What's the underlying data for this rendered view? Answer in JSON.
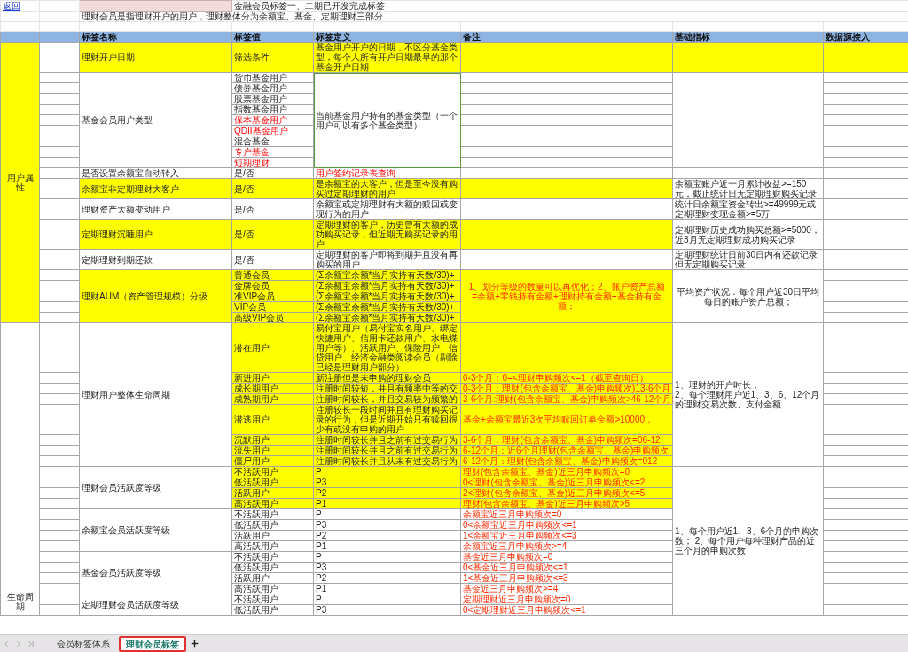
{
  "back_link": "返回",
  "title": "金融会员标签一、二期已开发完成标签",
  "description": "理财会员是指理财开户的用户，理财整体分为余额宝、基金、定期理财三部分",
  "columns": [
    "标签名称",
    "标签值",
    "标签定义",
    "备注",
    "基础指标",
    "数据源接入"
  ],
  "sections": [
    {
      "category": "用户属性",
      "highlighted": true,
      "blocks": [
        {
          "highlighted": true,
          "groups": [
            {
              "name": "理财开户日期",
              "highlighted": true,
              "definition_red": false,
              "rows": [
                {
                  "value": "筛选条件",
                  "red": false,
                  "highlighted": true,
                  "definition": "基金用户开户的日期，不区分基金类型，每个人所有开户日期最早的那个基金开户日期"
                }
              ]
            }
          ]
        },
        {
          "highlighted": false,
          "groups": [
            {
              "name": "基金会员用户类型",
              "highlighted": false,
              "definition_red": false,
              "definition": "当前基金用户持有的基金类型（一个用户可以有多个基金类型）",
              "rows": [
                {
                  "value": "货币基金用户",
                  "red": false,
                  "highlighted": false
                },
                {
                  "value": "债券基金用户",
                  "red": false,
                  "highlighted": false
                },
                {
                  "value": "股票基金用户",
                  "red": false,
                  "highlighted": false
                },
                {
                  "value": "指数基金用户",
                  "red": false,
                  "highlighted": false
                },
                {
                  "value": "保本基金用户",
                  "red": true,
                  "highlighted": false
                },
                {
                  "value": "QDII基金用户",
                  "red": true,
                  "highlighted": false
                },
                {
                  "value": "混合基金",
                  "red": false,
                  "highlighted": false
                },
                {
                  "value": "专户基金",
                  "red": true,
                  "highlighted": false
                },
                {
                  "value": "短期理财",
                  "red": true,
                  "highlighted": false
                }
              ]
            }
          ]
        },
        {
          "highlighted": false,
          "groups": [
            {
              "name": "是否设置余额宝自动转入",
              "highlighted": false,
              "definition_red": true,
              "rows": [
                {
                  "value": "是/否",
                  "red": false,
                  "highlighted": false,
                  "definition": "用户签约记录表查询"
                }
              ]
            }
          ]
        },
        {
          "highlighted": false,
          "metric": "余额宝账户近一月累计收益>=150元，截止统计日无定期理财购买记录",
          "groups": [
            {
              "name": "余额宝非定期理财大客户",
              "highlighted": true,
              "definition_red": false,
              "rows": [
                {
                  "value": "是/否",
                  "red": false,
                  "highlighted": true,
                  "definition": "是余额宝的大客户，但是至今没有购买过定期理财的用户"
                }
              ]
            }
          ]
        },
        {
          "highlighted": false,
          "metric": "统计日余额宝资金转出>=49999元或定期理财变现金额>=5万",
          "groups": [
            {
              "name": "理财资产大额变动用户",
              "highlighted": false,
              "definition_red": false,
              "rows": [
                {
                  "value": "是/否",
                  "red": false,
                  "highlighted": false,
                  "definition": "余额宝或定期理财有大额的赎回或变现行为的用户"
                }
              ]
            }
          ]
        },
        {
          "highlighted": false,
          "metric": "定期理财历史成功购买总额>=5000，近3月无定期理财成功购买记录",
          "groups": [
            {
              "name": "定期理财沉睡用户",
              "highlighted": true,
              "definition_red": false,
              "rows": [
                {
                  "value": "是/否",
                  "red": false,
                  "highlighted": true,
                  "definition": "定期理财的客户，历史曾有大额的成功购买记录，但近期无购买记录的用户"
                }
              ]
            }
          ]
        },
        {
          "highlighted": false,
          "metric": "定期理财统计日前30日内有还款记录但无定期购买记录",
          "groups": [
            {
              "name": "定期理财到期还款",
              "highlighted": false,
              "definition_red": false,
              "rows": [
                {
                  "value": "是/否",
                  "red": false,
                  "highlighted": false,
                  "definition": "定期理财的客户即将到期并且没有再购买的用户"
                }
              ]
            }
          ]
        },
        {
          "highlighted": false,
          "metric": "平均资产状况：每个用户近30日平均每日的账户资产总额；",
          "groups": [
            {
              "name": "理财AUM（资产管理规模）分级",
              "highlighted": true,
              "definition_red": false,
              "note": "1、划分等级的数量可以再优化；2、账户资产总额=余额+零钱持有金额+理财持有金额+基金持有金额；",
              "rows": [
                {
                  "value": "普通会员",
                  "red": false,
                  "highlighted": true,
                  "definition": "(Σ余额宝余额*当月实持有天数/30)+"
                },
                {
                  "value": "金牌会员",
                  "red": false,
                  "highlighted": true,
                  "definition": "(Σ余额宝余额*当月实持有天数/30)+"
                },
                {
                  "value": "准VIP会员",
                  "red": false,
                  "highlighted": true,
                  "definition": "(Σ余额宝余额*当月实持有天数/30)+"
                },
                {
                  "value": "VIP会员",
                  "red": false,
                  "highlighted": true,
                  "definition": "(Σ余额宝余额*当月实持有天数/30)+"
                },
                {
                  "value": "高级VIP会员",
                  "red": false,
                  "highlighted": true,
                  "definition": "(Σ余额宝余额*当月实持有天数/30)+"
                }
              ]
            }
          ]
        }
      ]
    },
    {
      "category": "生命周期",
      "highlighted": false,
      "blocks": [
        {
          "highlighted": false,
          "metric": "1、理财的开户时长；\n2、每个理财用户近1、3、6、12个月的理财交易次数、支付金额",
          "groups": [
            {
              "name": "理财用户整体生命周期",
              "highlighted": false,
              "definition_red": false,
              "rows": [
                {
                  "value": "潜在用户",
                  "red": false,
                  "highlighted": true,
                  "definition": "易付宝用户（易付宝实名用户、绑定快捷用户、信用卡还款用户、水电煤用户等）、活跃用户、保险用户、信贷用户、经济金融类阅读会员（剔除已经是理财用户部分）"
                },
                {
                  "value": "新进用户",
                  "red": false,
                  "highlighted": true,
                  "definition": "新注册但是未申购的理财会员",
                  "note": "0-3个月：0=<理财申购频次<=1（截至查询日）"
                },
                {
                  "value": "成长期用户",
                  "red": false,
                  "highlighted": true,
                  "definition": "注册时间较短，并且有频率中等的交",
                  "note": "0-3个月：理财(包含余额宝、基金)申购频次)13-6个月"
                },
                {
                  "value": "成熟期用户",
                  "red": false,
                  "highlighted": true,
                  "definition": "注册时间较长，并且交易较为频繁的",
                  "note": "3-6个月:理财(包含余额宝、基金)申购频次>46-12个月:"
                },
                {
                  "value": "潜逃用户",
                  "red": false,
                  "highlighted": true,
                  "definition": "注册较长一段时间并且有理财购买记录的行为，但是近期开始只有赎回很少有或没有申购的用户",
                  "note": "基金+余额宝最近3次平均赎回订单金额>10000，"
                },
                {
                  "value": "沉默用户",
                  "red": false,
                  "highlighted": true,
                  "definition": "注册时间较长并且之前有过交易行为",
                  "note": "3-6个月：理财(包含余额宝、基金)申购频次=06-12"
                },
                {
                  "value": "流失用户",
                  "red": false,
                  "highlighted": true,
                  "definition": "注册时间较长并且之前有过交易行为",
                  "note": "6-12个月：近6个月理财(包含余额宝、基金)申购频次"
                },
                {
                  "value": "僵尸用户",
                  "red": false,
                  "highlighted": true,
                  "definition": "注册时间较长并且从未有过交易行为",
                  "note": "6-12个月：理财(包含余额宝、基金)申购频次=012"
                }
              ]
            }
          ]
        },
        {
          "highlighted": false,
          "metric": "1、每个用户近1、3、6个月的申购次数；   2、每个用户每种理财产品的近三个月的申购次数",
          "groups": [
            {
              "name": "理财会员活跃度等级",
              "highlighted": false,
              "definition_red": false,
              "rows": [
                {
                  "value": "不活跃用户",
                  "red": false,
                  "highlighted": true,
                  "definition": "P",
                  "note": "理财(包含余额宝、基金)近三月申购频次=0"
                },
                {
                  "value": "低活跃用户",
                  "red": false,
                  "highlighted": true,
                  "definition": "P3",
                  "note": "0<理财(包含余额宝、基金)近三月申购频次<=2"
                },
                {
                  "value": "活跃用户",
                  "red": false,
                  "highlighted": true,
                  "definition": "P2",
                  "note": "2<理财(包含余额宝、基金)近三月申购频次<=5"
                },
                {
                  "value": "高活跃用户",
                  "red": false,
                  "highlighted": true,
                  "definition": "P1",
                  "note": "理财(包含余额宝、基金)近三月申购频次>5"
                }
              ]
            },
            {
              "name": "余额宝会员活跃度等级",
              "highlighted": false,
              "definition_red": false,
              "rows": [
                {
                  "value": "不活跃用户",
                  "red": false,
                  "highlighted": false,
                  "definition": "P",
                  "note": "余额宝近三月申购频次=0"
                },
                {
                  "value": "低活跃用户",
                  "red": false,
                  "highlighted": false,
                  "definition": "P3",
                  "note": "0<余额宝近三月申购频次<=1"
                },
                {
                  "value": "活跃用户",
                  "red": false,
                  "highlighted": false,
                  "definition": "P2",
                  "note": "1<余额宝近三月申购频次<=3"
                },
                {
                  "value": "高活跃用户",
                  "red": false,
                  "highlighted": false,
                  "definition": "P1",
                  "note": "余额宝近三月申购频次>=4"
                }
              ]
            },
            {
              "name": "基金会员活跃度等级",
              "highlighted": false,
              "definition_red": false,
              "rows": [
                {
                  "value": "不活跃用户",
                  "red": false,
                  "highlighted": false,
                  "definition": "P",
                  "note": "基金近三月申购频次=0"
                },
                {
                  "value": "低活跃用户",
                  "red": false,
                  "highlighted": false,
                  "definition": "P3",
                  "note": "0<基金近三月申购频次<=1"
                },
                {
                  "value": "活跃用户",
                  "red": false,
                  "highlighted": false,
                  "definition": "P2",
                  "note": "1<基金近三月申购频次<=3"
                },
                {
                  "value": "高活跃用户",
                  "red": false,
                  "highlighted": false,
                  "definition": "P1",
                  "note": "基金近三月申购频次>=4"
                }
              ]
            },
            {
              "name": "定期理财会员活跃度等级",
              "highlighted": false,
              "definition_red": false,
              "rows": [
                {
                  "value": "不活跃用户",
                  "red": false,
                  "highlighted": false,
                  "definition": "P",
                  "note": "定期理财近三月申购频次=0"
                },
                {
                  "value": "低活跃用户",
                  "red": false,
                  "highlighted": false,
                  "definition": "P3",
                  "note": "0<定期理财近三月申购频次<=1"
                }
              ]
            }
          ]
        }
      ]
    }
  ],
  "sheet_tabs": [
    {
      "label": "会员标签体系",
      "selected": false
    },
    {
      "label": "理财会员标签",
      "selected": true
    }
  ]
}
